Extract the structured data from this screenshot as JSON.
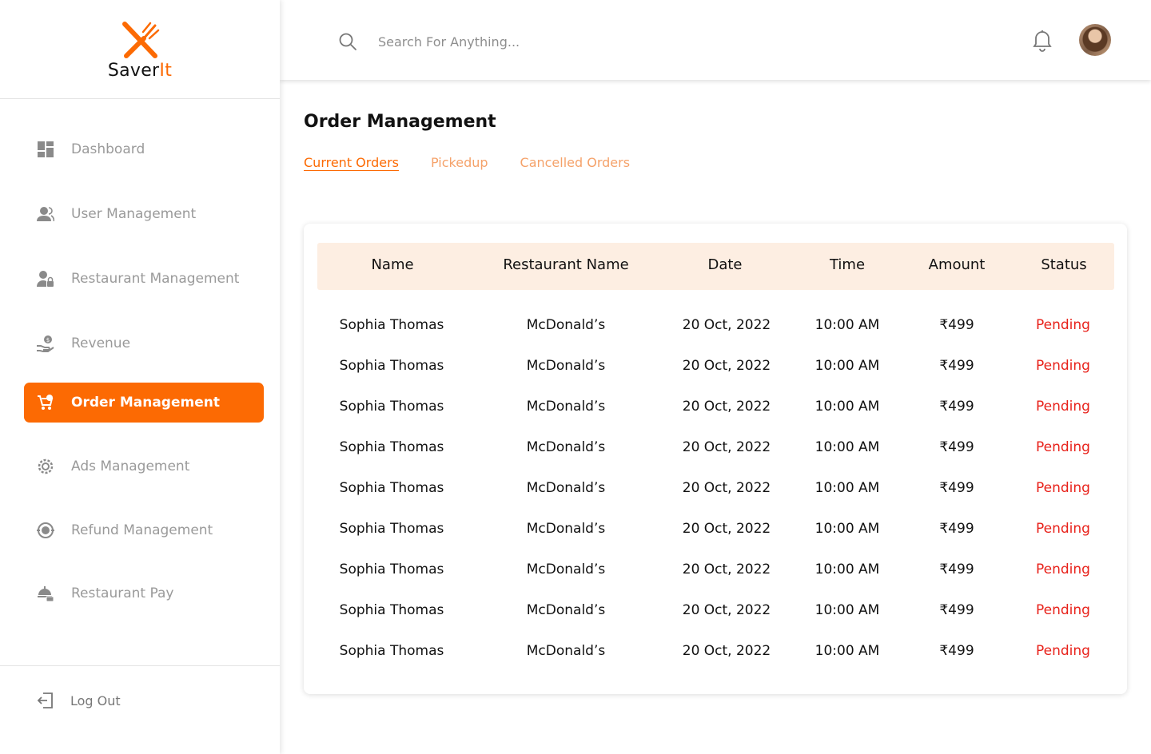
{
  "app": {
    "logo_text_main": "Saver",
    "logo_text_accent": "It"
  },
  "sidebar": {
    "items": [
      {
        "label": "Dashboard",
        "icon": "dashboard-icon"
      },
      {
        "label": "User Management",
        "icon": "users-icon"
      },
      {
        "label": "Restaurant Management",
        "icon": "restaurant-user-icon"
      },
      {
        "label": "Revenue",
        "icon": "revenue-hand-icon"
      },
      {
        "label": "Order Management",
        "icon": "order-cart-icon"
      },
      {
        "label": "Ads Management",
        "icon": "ads-gear-icon"
      },
      {
        "label": "Refund Management",
        "icon": "refund-icon"
      },
      {
        "label": "Restaurant Pay",
        "icon": "restaurant-pay-icon"
      }
    ],
    "active_item": "Order Management",
    "logout_label": "Log Out"
  },
  "header": {
    "search_placeholder": "Search For Anything..."
  },
  "main": {
    "title": "Order Management",
    "tabs": [
      {
        "label": "Current Orders",
        "active": true
      },
      {
        "label": "Pickedup",
        "active": false
      },
      {
        "label": "Cancelled Orders",
        "active": false
      }
    ],
    "table": {
      "columns": [
        "Name",
        "Restaurant Name",
        "Date",
        "Time",
        "Amount",
        "Status"
      ],
      "rows": [
        [
          "Sophia Thomas",
          "McDonald’s",
          "20 Oct, 2022",
          "10:00 AM",
          "₹499",
          "Pending"
        ],
        [
          "Sophia Thomas",
          "McDonald’s",
          "20 Oct, 2022",
          "10:00 AM",
          "₹499",
          "Pending"
        ],
        [
          "Sophia Thomas",
          "McDonald’s",
          "20 Oct, 2022",
          "10:00 AM",
          "₹499",
          "Pending"
        ],
        [
          "Sophia Thomas",
          "McDonald’s",
          "20 Oct, 2022",
          "10:00 AM",
          "₹499",
          "Pending"
        ],
        [
          "Sophia Thomas",
          "McDonald’s",
          "20 Oct, 2022",
          "10:00 AM",
          "₹499",
          "Pending"
        ],
        [
          "Sophia Thomas",
          "McDonald’s",
          "20 Oct, 2022",
          "10:00 AM",
          "₹499",
          "Pending"
        ],
        [
          "Sophia Thomas",
          "McDonald’s",
          "20 Oct, 2022",
          "10:00 AM",
          "₹499",
          "Pending"
        ],
        [
          "Sophia Thomas",
          "McDonald’s",
          "20 Oct, 2022",
          "10:00 AM",
          "₹499",
          "Pending"
        ],
        [
          "Sophia Thomas",
          "McDonald’s",
          "20 Oct, 2022",
          "10:00 AM",
          "₹499",
          "Pending"
        ]
      ]
    }
  },
  "colors": {
    "accent": "#fc6a03",
    "tab_inactive": "#f5a26a",
    "table_header_bg": "#fdeee2",
    "status_pending": "#e8211a",
    "nav_inactive": "#9a9a9a"
  }
}
